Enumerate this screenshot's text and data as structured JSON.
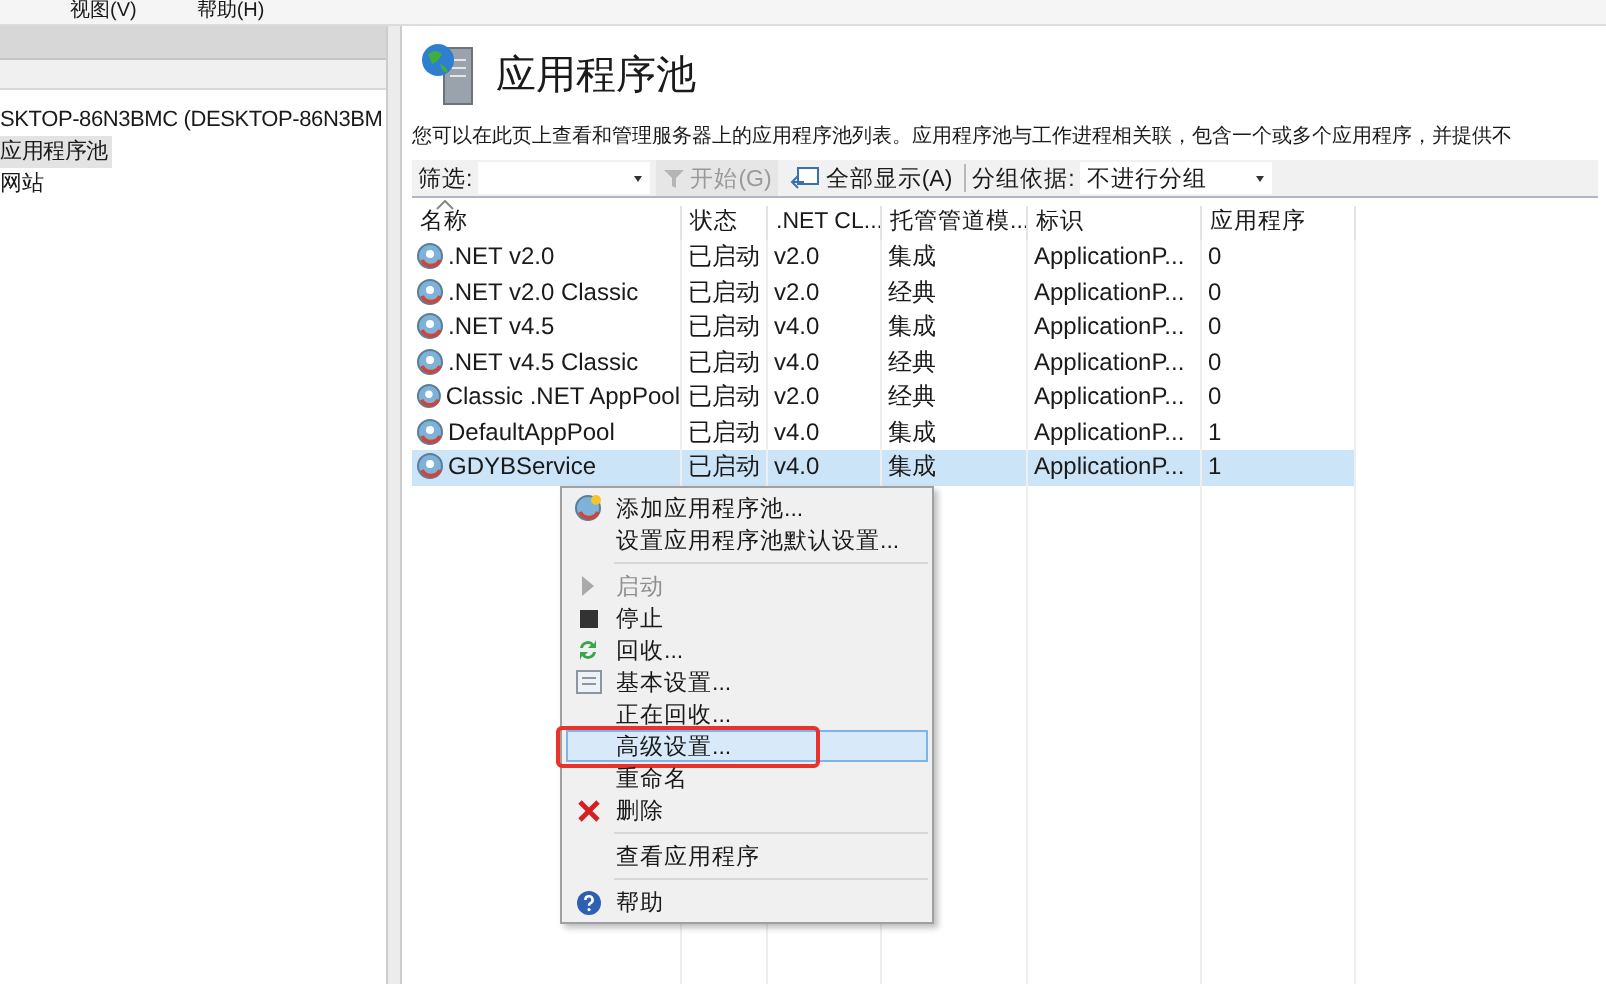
{
  "menubar": [
    "视图(V)",
    "帮助(H)"
  ],
  "tree": [
    {
      "label": "SKTOP-86N3BMC (DESKTOP-86N3BM",
      "selected": false,
      "children": [
        {
          "label": "应用程序池",
          "selected": true
        },
        {
          "label": "网站",
          "selected": false
        }
      ]
    }
  ],
  "page": {
    "title": "应用程序池",
    "description": "您可以在此页上查看和管理服务器上的应用程序池列表。应用程序池与工作进程相关联，包含一个或多个应用程序，并提供不"
  },
  "toolbar": {
    "filter_label": "筛选:",
    "start_button": {
      "label": "开始(G)",
      "disabled": true
    },
    "show_all_button": "全部显示(A)",
    "group_label": "分组依据:",
    "group_value": "不进行分组"
  },
  "table": {
    "columns": [
      "名称",
      "状态",
      ".NET CL...",
      "托管管道模...",
      "标识",
      "应用程序"
    ],
    "rows": [
      {
        "cells": [
          ".NET v2.0",
          "已启动",
          "v2.0",
          "集成",
          "ApplicationP...",
          "0"
        ],
        "selected": false
      },
      {
        "cells": [
          ".NET v2.0 Classic",
          "已启动",
          "v2.0",
          "经典",
          "ApplicationP...",
          "0"
        ],
        "selected": false
      },
      {
        "cells": [
          ".NET v4.5",
          "已启动",
          "v4.0",
          "集成",
          "ApplicationP...",
          "0"
        ],
        "selected": false
      },
      {
        "cells": [
          ".NET v4.5 Classic",
          "已启动",
          "v4.0",
          "经典",
          "ApplicationP...",
          "0"
        ],
        "selected": false
      },
      {
        "cells": [
          "Classic .NET AppPool",
          "已启动",
          "v2.0",
          "经典",
          "ApplicationP...",
          "0"
        ],
        "selected": false
      },
      {
        "cells": [
          "DefaultAppPool",
          "已启动",
          "v4.0",
          "集成",
          "ApplicationP...",
          "1"
        ],
        "selected": false
      },
      {
        "cells": [
          "GDYBService",
          "已启动",
          "v4.0",
          "集成",
          "ApplicationP...",
          "1"
        ],
        "selected": true
      }
    ]
  },
  "context_menu": [
    {
      "kind": "add",
      "label": "添加应用程序池...",
      "disabled": false,
      "highlighted": false,
      "marked": false
    },
    {
      "kind": "plain",
      "label": "设置应用程序池默认设置...",
      "disabled": false,
      "highlighted": false,
      "marked": false
    },
    {
      "kind": "separator"
    },
    {
      "kind": "start",
      "label": "启动",
      "disabled": true,
      "highlighted": false,
      "marked": false
    },
    {
      "kind": "stop",
      "label": "停止",
      "disabled": false,
      "highlighted": false,
      "marked": false
    },
    {
      "kind": "recycle",
      "label": "回收...",
      "disabled": false,
      "highlighted": false,
      "marked": false
    },
    {
      "kind": "basic",
      "label": "基本设置...",
      "disabled": false,
      "highlighted": false,
      "marked": false
    },
    {
      "kind": "plain",
      "label": "正在回收...",
      "disabled": false,
      "highlighted": false,
      "marked": false
    },
    {
      "kind": "plain",
      "label": "高级设置...",
      "disabled": false,
      "highlighted": true,
      "marked": true
    },
    {
      "kind": "plain",
      "label": "重命名",
      "disabled": false,
      "highlighted": false,
      "marked": false
    },
    {
      "kind": "delete",
      "label": "删除",
      "disabled": false,
      "highlighted": false,
      "marked": false
    },
    {
      "kind": "separator"
    },
    {
      "kind": "plain",
      "label": "查看应用程序",
      "disabled": false,
      "highlighted": false,
      "marked": false
    },
    {
      "kind": "separator"
    },
    {
      "kind": "help",
      "label": "帮助",
      "disabled": false,
      "highlighted": false,
      "marked": false
    }
  ]
}
